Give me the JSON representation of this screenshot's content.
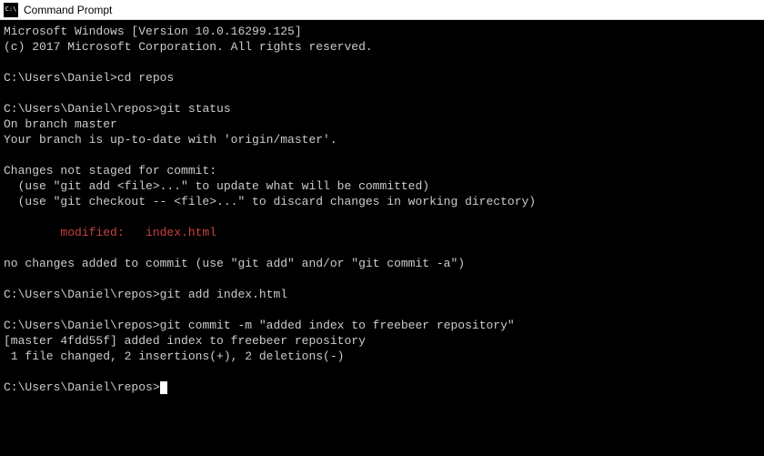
{
  "titlebar": {
    "title": "Command Prompt"
  },
  "term": {
    "l0": "Microsoft Windows [Version 10.0.16299.125]",
    "l1": "(c) 2017 Microsoft Corporation. All rights reserved.",
    "l2": "",
    "p1": "C:\\Users\\Daniel>",
    "c1": "cd repos",
    "l3": "",
    "p2": "C:\\Users\\Daniel\\repos>",
    "c2": "git status",
    "l4": "On branch master",
    "l5": "Your branch is up-to-date with 'origin/master'.",
    "l6": "",
    "l7": "Changes not staged for commit:",
    "l8": "  (use \"git add <file>...\" to update what will be committed)",
    "l9": "  (use \"git checkout -- <file>...\" to discard changes in working directory)",
    "l10": "",
    "l11_red": "        modified:   index.html",
    "l12": "",
    "l13": "no changes added to commit (use \"git add\" and/or \"git commit -a\")",
    "l14": "",
    "p3": "C:\\Users\\Daniel\\repos>",
    "c3": "git add index.html",
    "l15": "",
    "p4": "C:\\Users\\Daniel\\repos>",
    "c4": "git commit -m \"added index to freebeer repository\"",
    "l16": "[master 4fdd55f] added index to freebeer repository",
    "l17": " 1 file changed, 2 insertions(+), 2 deletions(-)",
    "l18": "",
    "p5": "C:\\Users\\Daniel\\repos>"
  }
}
